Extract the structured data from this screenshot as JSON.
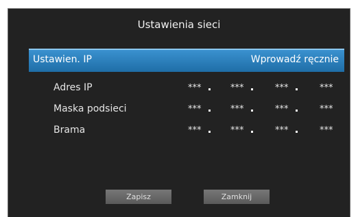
{
  "dialog": {
    "title": "Ustawienia sieci",
    "ip_setting": {
      "label": "Ustawien. IP",
      "value": "Wprowadź ręcznie"
    },
    "fields": [
      {
        "label": "Adres IP",
        "octets": [
          "***",
          "***",
          "***",
          "***"
        ]
      },
      {
        "label": "Maska podsieci",
        "octets": [
          "***",
          "***",
          "***",
          "***"
        ]
      },
      {
        "label": "Brama",
        "octets": [
          "***",
          "***",
          "***",
          "***"
        ]
      }
    ],
    "buttons": {
      "save": "Zapisz",
      "close": "Zamknij"
    }
  }
}
